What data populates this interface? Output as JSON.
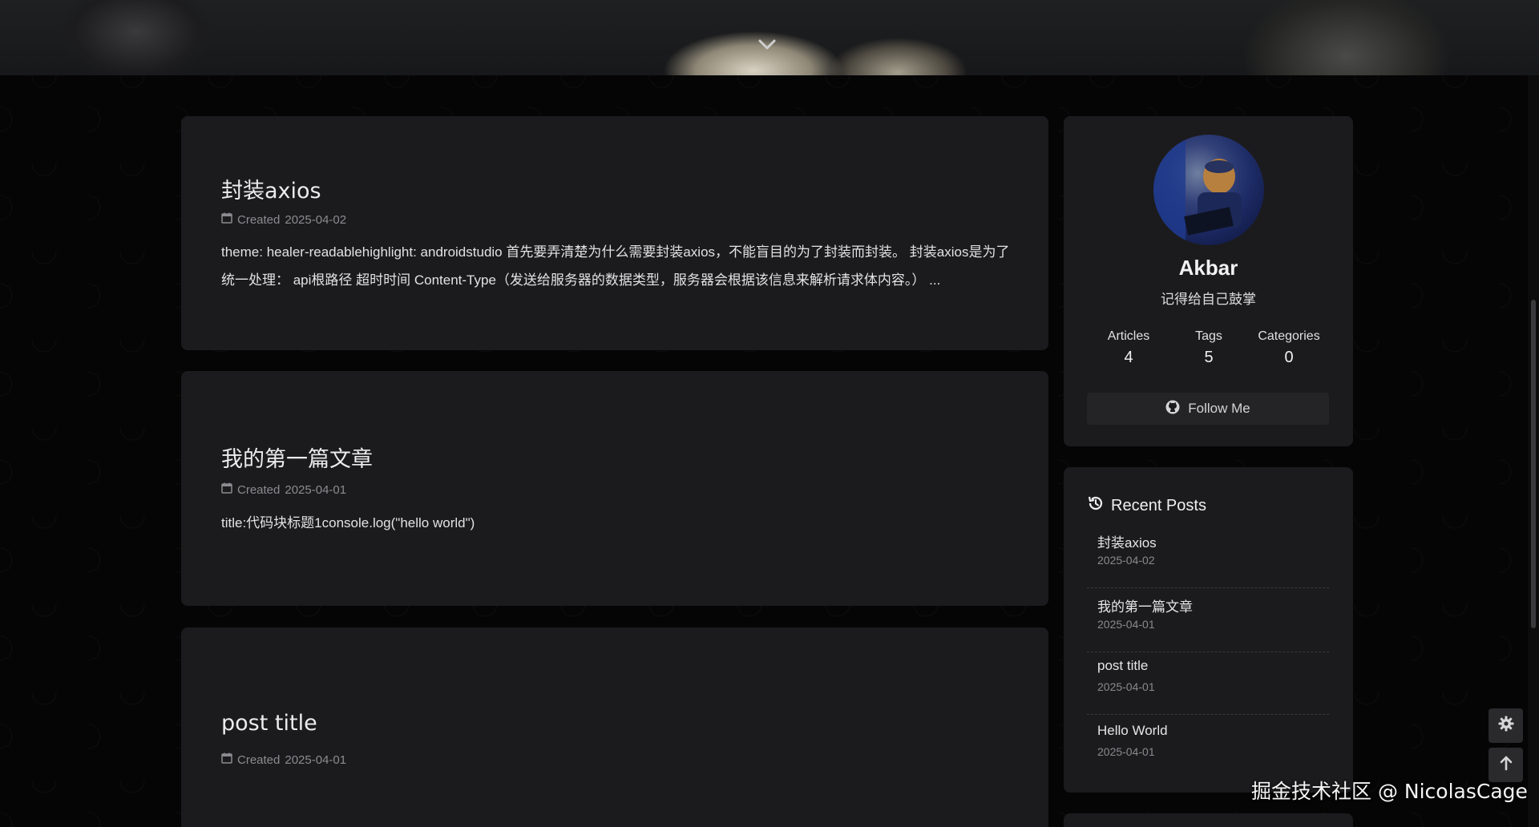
{
  "posts": [
    {
      "title": "封装axios",
      "created_label": "Created",
      "date": "2025-04-02",
      "excerpt": "theme: healer-readablehighlight: androidstudio 首先要弄清楚为什么需要封装axios，不能盲目的为了封装而封装。 封装axios是为了统一处理： api根路径 超时时间 Content-Type（发送给服务器的数据类型，服务器会根据该信息来解析请求体内容。） ..."
    },
    {
      "title": "我的第一篇文章",
      "created_label": "Created",
      "date": "2025-04-01",
      "excerpt": "title:代码块标题1console.log(\"hello world\")"
    },
    {
      "title": "post title",
      "created_label": "Created",
      "date": "2025-04-01",
      "excerpt": ""
    }
  ],
  "author": {
    "name": "Akbar",
    "description": "记得给自己鼓掌",
    "stats": [
      {
        "label": "Articles",
        "value": "4"
      },
      {
        "label": "Tags",
        "value": "5"
      },
      {
        "label": "Categories",
        "value": "0"
      }
    ],
    "follow_label": "Follow Me"
  },
  "recent_posts": {
    "heading": "Recent Posts",
    "items": [
      {
        "title": "封装axios",
        "date": "2025-04-02"
      },
      {
        "title": "我的第一篇文章",
        "date": "2025-04-01"
      },
      {
        "title": "post title",
        "date": "2025-04-01"
      },
      {
        "title": "Hello World",
        "date": "2025-04-01"
      }
    ]
  },
  "watermark": "掘金技术社区 @ NicolasCage",
  "icons": {
    "hero": "chevron-down-icon",
    "calendar": "calendar-icon",
    "github": "github-icon",
    "history": "history-icon",
    "settings": "gear-icon",
    "back_to_top": "arrow-up-icon"
  },
  "colors": {
    "background": "#050506",
    "card": "#1b1b1d",
    "text": "#e8e8ea",
    "muted": "#8c8c90"
  }
}
